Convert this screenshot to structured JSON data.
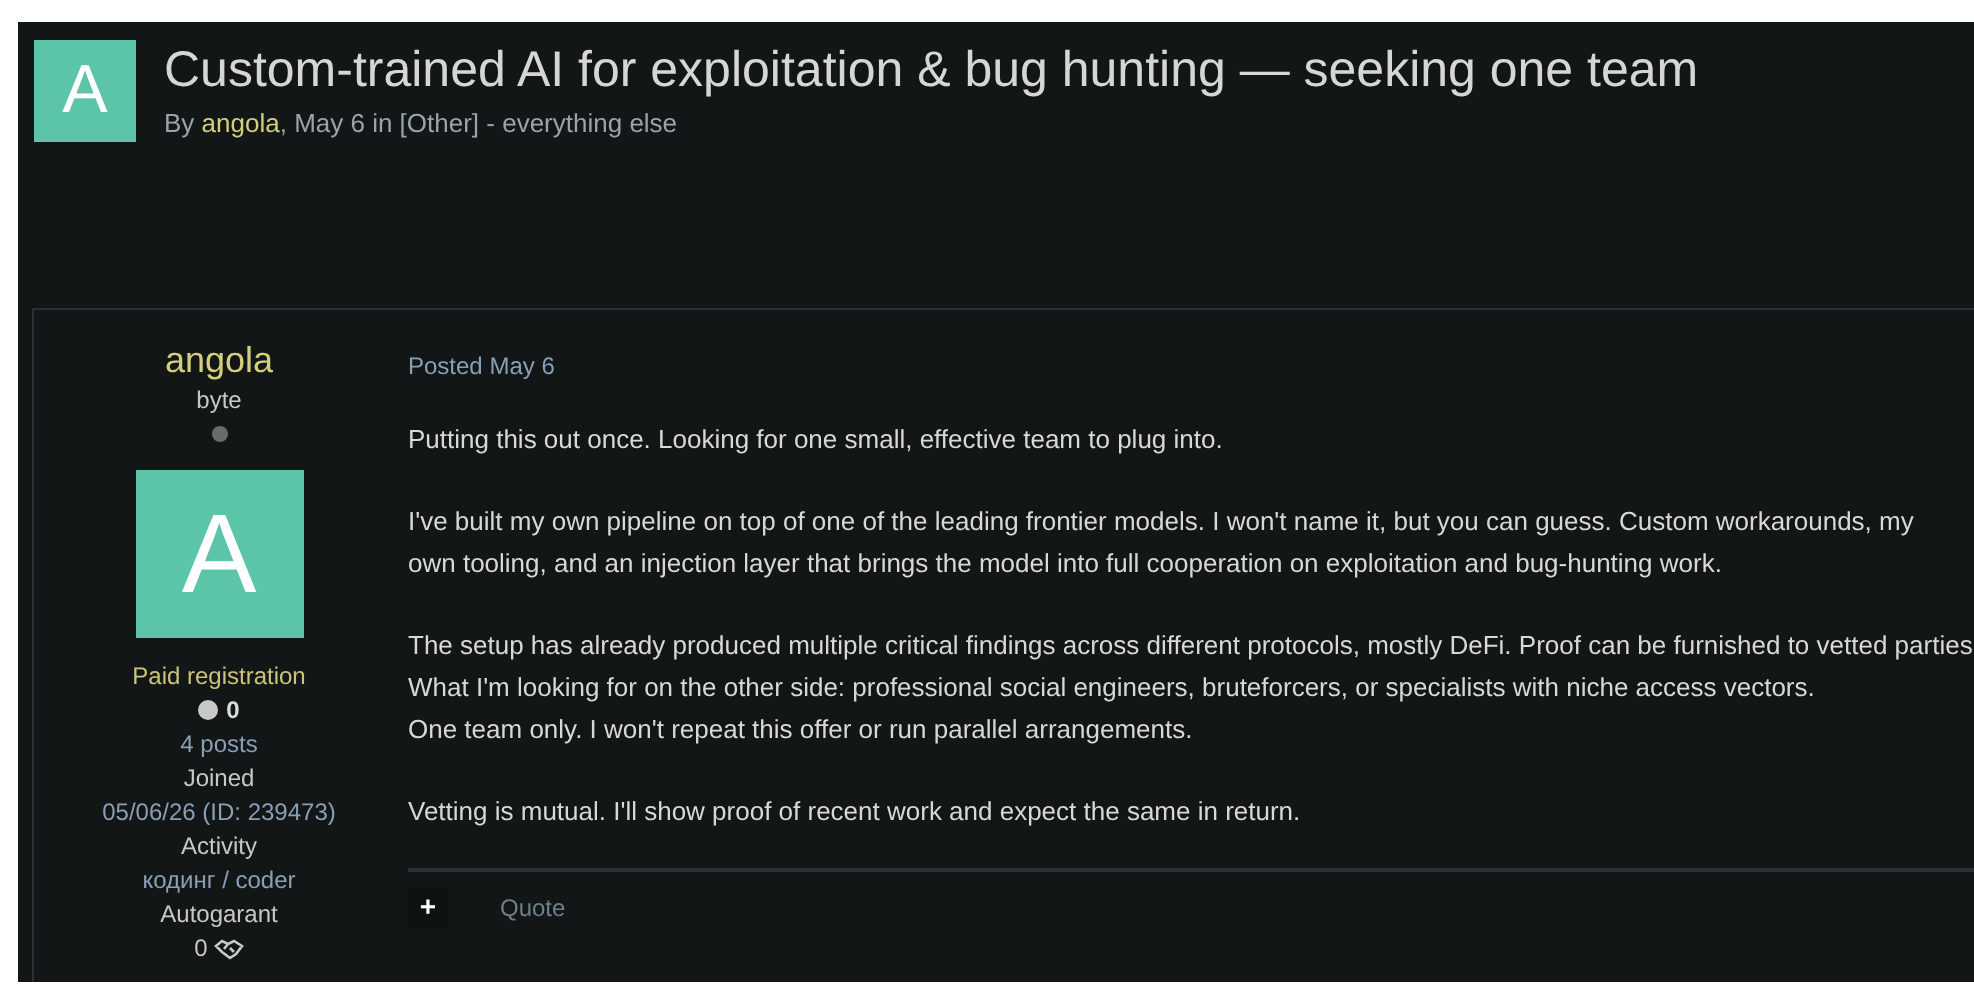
{
  "topic": {
    "avatar_letter": "A",
    "title": "Custom-trained AI for exploitation & bug hunting — seeking one team",
    "by": "By",
    "author": "angola",
    "meta": ", May 6 in [Other] - everything else"
  },
  "author_panel": {
    "name": "angola",
    "rank": "byte",
    "online": false,
    "avatar_letter": "A",
    "group": "Paid registration",
    "reputation": "0",
    "posts": "4 posts",
    "joined_label": "Joined",
    "joined": "05/06/26 (ID: 239473)",
    "activity_label": "Activity",
    "activity": "кодинг / coder",
    "autogarant_label": "Autogarant",
    "autogarant": "0"
  },
  "post": {
    "posted": "Posted May 6",
    "paragraphs": [
      [
        "Putting this out once. Looking for one small, effective team to plug into."
      ],
      [
        "I've built my own pipeline on top of one of the leading frontier models. I won't name it, but you can guess. Custom workarounds, my",
        "own tooling, and an injection layer that brings the model into full cooperation on exploitation and bug-hunting work."
      ],
      [
        "The setup has already produced multiple critical findings across different protocols, mostly DeFi. Proof can be furnished to vetted parties",
        "What I'm looking for on the other side: professional social engineers, bruteforcers, or specialists with niche access vectors.",
        "One team only. I won't repeat this offer or run parallel arrangements."
      ],
      [
        "Vetting is mutual. I'll show proof of recent work and expect the same in return."
      ]
    ],
    "plus": "+",
    "quote": "Quote"
  }
}
